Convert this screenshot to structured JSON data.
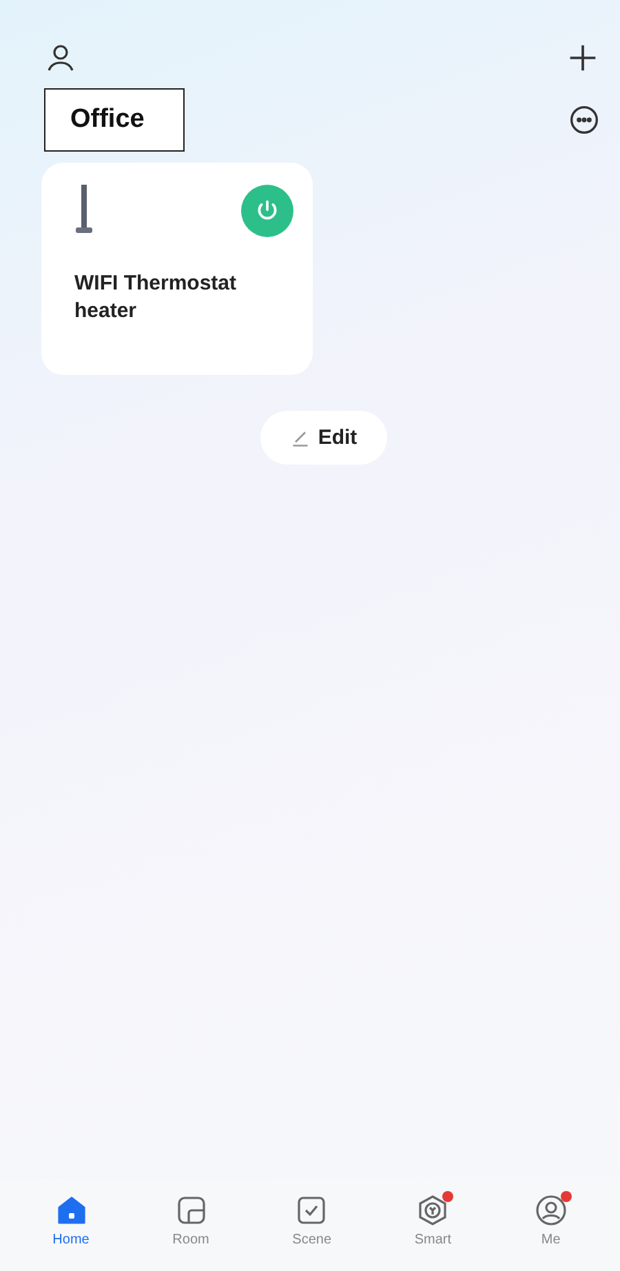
{
  "room_title": "Office",
  "devices": [
    {
      "name": "WIFI Thermostat heater",
      "on": true
    }
  ],
  "edit_button": "Edit",
  "nav": [
    {
      "label": "Home",
      "kind": "home",
      "selected": true,
      "badge": false
    },
    {
      "label": "Room",
      "kind": "room",
      "selected": false,
      "badge": false
    },
    {
      "label": "Scene",
      "kind": "scene",
      "selected": false,
      "badge": false
    },
    {
      "label": "Smart",
      "kind": "smart",
      "selected": false,
      "badge": true
    },
    {
      "label": "Me",
      "kind": "me",
      "selected": false,
      "badge": true
    }
  ]
}
